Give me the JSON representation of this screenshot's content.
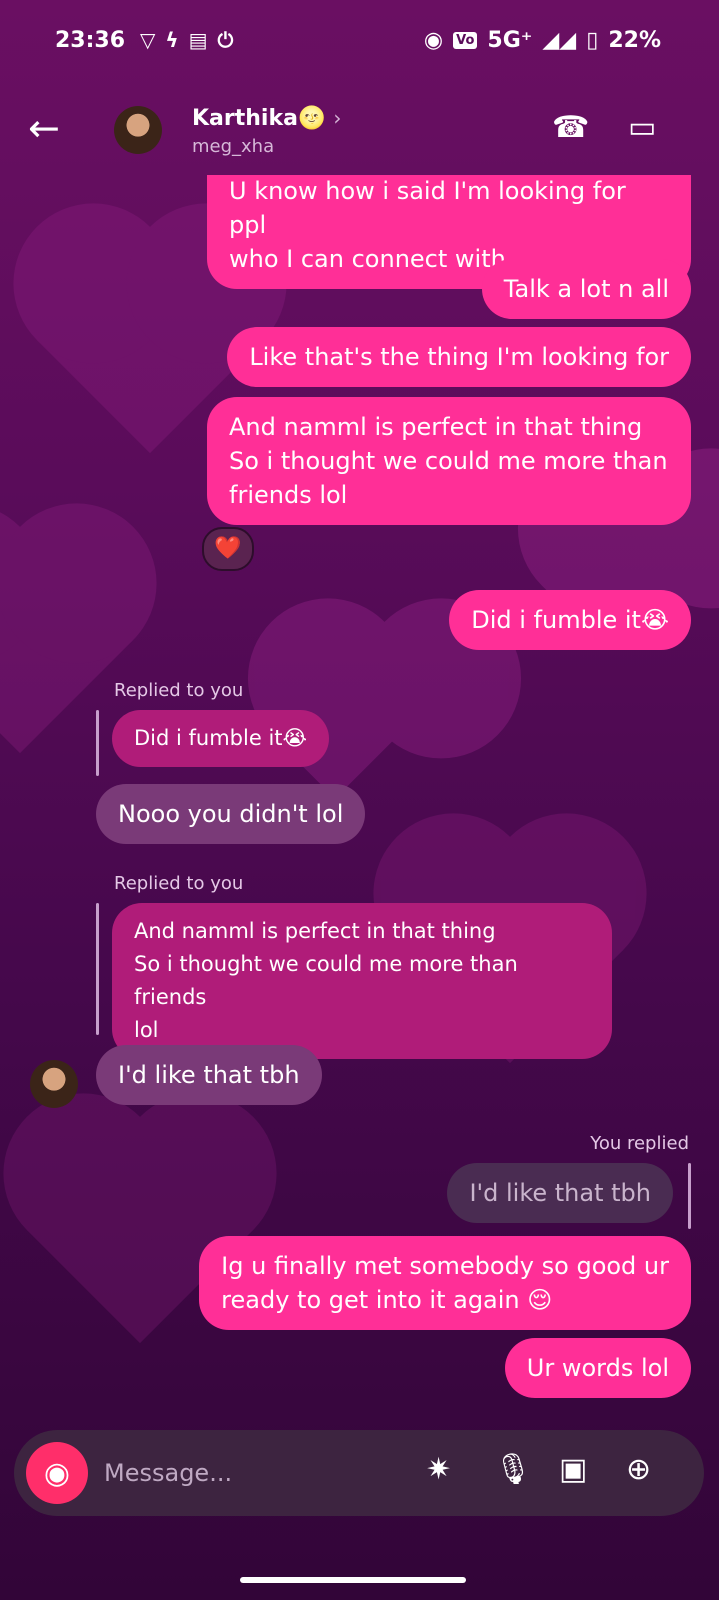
{
  "status_bar": {
    "time": "23:36",
    "network": "5G⁺",
    "battery": "22%",
    "left_icons": [
      "vpn-icon",
      "flash-icon",
      "calendar-icon",
      "power-icon"
    ],
    "right_icons": [
      "hotspot-icon",
      "volte-icon",
      "signal-icon",
      "battery-icon"
    ]
  },
  "header": {
    "contact_name": "Karthika🌝",
    "username": "meg_xha"
  },
  "messages": [
    {
      "text": "U know how i said I'm looking for ppl\nwho I can connect with"
    },
    {
      "text": "Talk a lot n all"
    },
    {
      "text": "Like that's the thing I'm looking for"
    },
    {
      "text": "And namml is perfect in that thing\nSo i thought we could me more than\nfriends lol"
    },
    {
      "text": "Did i fumble it😭"
    }
  ],
  "reaction": "❤️",
  "reply_1": {
    "label": "Replied to you",
    "quoted": "Did i fumble it😭",
    "text": "Nooo you didn't lol"
  },
  "reply_2": {
    "label": "Replied to you",
    "quoted": "And namml is perfect in that thing\nSo i thought we could me more than friends\nlol",
    "text": "I'd like that tbh"
  },
  "you_replied": {
    "label": "You replied",
    "quoted": "I'd like that tbh"
  },
  "messages_after": [
    {
      "text": "Ig u finally met somebody so good ur\nready to get into it again 😌"
    },
    {
      "text": "Ur words lol"
    }
  ],
  "composer": {
    "placeholder": "Message..."
  }
}
